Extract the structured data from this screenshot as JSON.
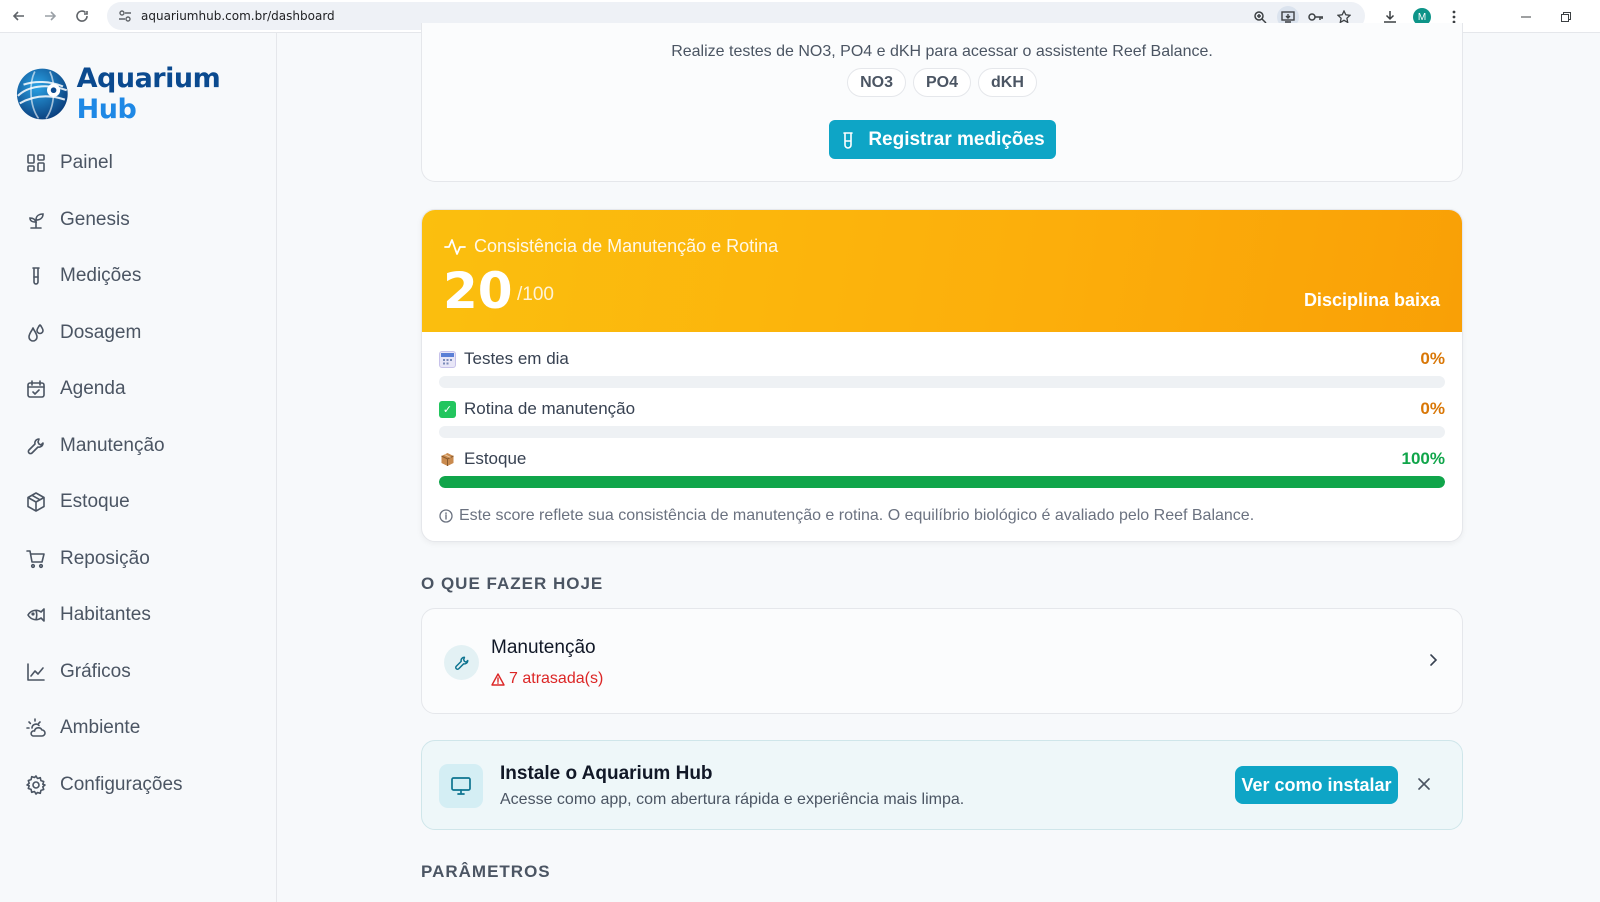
{
  "browser": {
    "url": "aquariumhub.com.br/dashboard",
    "profile_initial": "M"
  },
  "brand": {
    "name_part1": "Aquarium",
    "name_part2": "Hub",
    "color_dark": "#0b4a8f",
    "color_light": "#1e88e5"
  },
  "sidebar": {
    "items": [
      {
        "label": "Painel",
        "icon": "grid-icon"
      },
      {
        "label": "Genesis",
        "icon": "sprout-icon"
      },
      {
        "label": "Medições",
        "icon": "test-tube-icon"
      },
      {
        "label": "Dosagem",
        "icon": "droplets-icon"
      },
      {
        "label": "Agenda",
        "icon": "calendar-icon"
      },
      {
        "label": "Manutenção",
        "icon": "wrench-icon"
      },
      {
        "label": "Estoque",
        "icon": "package-icon"
      },
      {
        "label": "Reposição",
        "icon": "cart-icon"
      },
      {
        "label": "Habitantes",
        "icon": "fish-icon"
      },
      {
        "label": "Gráficos",
        "icon": "line-chart-icon"
      },
      {
        "label": "Ambiente",
        "icon": "cloud-sun-icon"
      },
      {
        "label": "Configurações",
        "icon": "gear-icon"
      }
    ]
  },
  "reef_balance": {
    "message": "Realize testes de NO3, PO4 e dKH para acessar o assistente Reef Balance.",
    "chips": [
      "NO3",
      "PO4",
      "dKH"
    ],
    "button_label": "Registrar medições"
  },
  "consistency": {
    "title": "Consistência de Manutenção e Rotina",
    "score": "20",
    "max": "/100",
    "status": "Disciplina baixa",
    "metrics": [
      {
        "label": "Testes em dia",
        "percent_text": "0%",
        "value": 0,
        "icon": "calendar-emoji-icon",
        "color": "#d97706"
      },
      {
        "label": "Rotina de manutenção",
        "percent_text": "0%",
        "value": 0,
        "icon": "check-box-icon",
        "color": "#d97706"
      },
      {
        "label": "Estoque",
        "percent_text": "100%",
        "value": 100,
        "icon": "box-emoji-icon",
        "color": "#10a54a"
      }
    ],
    "note": "Este score reflete sua consistência de manutenção e rotina. O equilíbrio biológico é avaliado pelo Reef Balance.",
    "header_color": "#fbbf0e"
  },
  "today": {
    "section_title": "O QUE FAZER HOJE",
    "task_title": "Manutenção",
    "task_alert": "7 atrasada(s)"
  },
  "install": {
    "title": "Instale o Aquarium Hub",
    "subtitle": "Acesse como app, com abertura rápida e experiência mais limpa.",
    "button_label": "Ver como instalar"
  },
  "params": {
    "section_title": "PARÂMETROS"
  },
  "accent_color": "#0ea5c6"
}
